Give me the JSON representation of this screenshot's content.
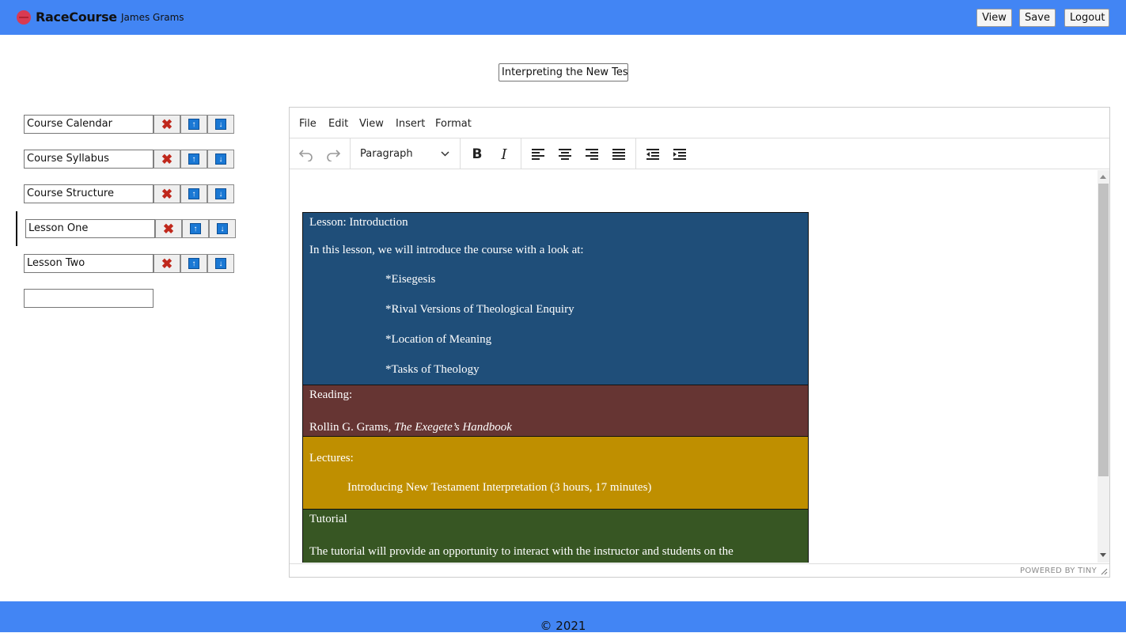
{
  "header": {
    "brand": "RaceCourse",
    "user": "James Grams",
    "buttons": {
      "view": "View",
      "save": "Save",
      "logout": "Logout"
    }
  },
  "course_title": "Interpreting the New Testament",
  "sidebar": {
    "items": [
      {
        "label": "Course Calendar"
      },
      {
        "label": "Course Syllabus"
      },
      {
        "label": "Course Structure"
      },
      {
        "label": "Lesson One",
        "active": true
      },
      {
        "label": "Lesson Two"
      }
    ],
    "new_item_value": "",
    "delete_icon": "✖",
    "up_icon": "↑",
    "down_icon": "↓"
  },
  "editor": {
    "menu": [
      "File",
      "Edit",
      "View",
      "Insert",
      "Format"
    ],
    "block_format": "Paragraph",
    "powered_by": "POWERED BY TINY",
    "content": {
      "intro_heading": "Lesson: Introduction",
      "intro_text": "In this lesson, we will introduce the course with a look at:",
      "topics": [
        "*Eisegesis",
        "*Rival Versions of Theological Enquiry",
        "*Location of Meaning",
        "*Tasks of Theology"
      ],
      "reading_heading": "Reading:",
      "reading_author": "Rollin G. Grams, ",
      "reading_title": "The Exegete’s Handbook",
      "lectures_heading": "Lectures:",
      "lecture_item": "Introducing New Testament Interpretation (3 hours, 17 minutes)",
      "tutorial_heading": "Tutorial",
      "tutorial_text": "The tutorial will provide an opportunity to interact with the instructor and students on the"
    },
    "colors": {
      "intro": "#1f4e79",
      "reading": "#663533",
      "lectures": "#bf8f00",
      "tutorial": "#375623"
    }
  },
  "footer": {
    "copyright": "© 2021"
  },
  "colors": {
    "accent": "#4285f4"
  }
}
